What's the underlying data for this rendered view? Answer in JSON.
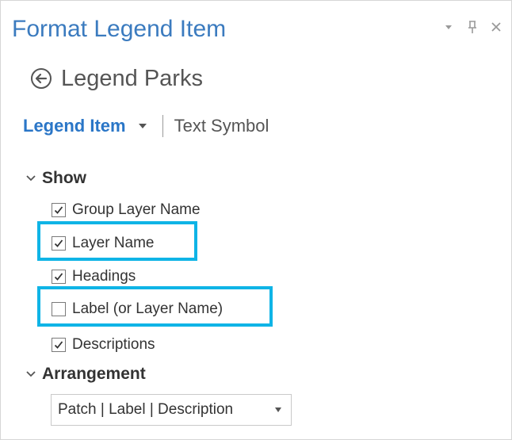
{
  "pane": {
    "title": "Format Legend Item",
    "controls": {
      "menu": "menu-down-icon",
      "pin": "pin-icon",
      "close": "close-icon"
    },
    "back_label": "Legend Parks"
  },
  "tabs": {
    "active": "Legend Item",
    "other": "Text Symbol"
  },
  "show": {
    "header": "Show",
    "items": [
      {
        "label": "Group Layer Name",
        "checked": true
      },
      {
        "label": "Layer Name",
        "checked": true,
        "highlighted": true
      },
      {
        "label": "Headings",
        "checked": true
      },
      {
        "label": "Label (or Layer Name)",
        "checked": false,
        "highlighted": true
      },
      {
        "label": "Descriptions",
        "checked": true
      }
    ]
  },
  "arrangement": {
    "header": "Arrangement",
    "selected": "Patch | Label | Description"
  },
  "colors": {
    "title": "#3b7bbf",
    "active_tab": "#2a76c7",
    "highlight": "#0fb4e6"
  }
}
